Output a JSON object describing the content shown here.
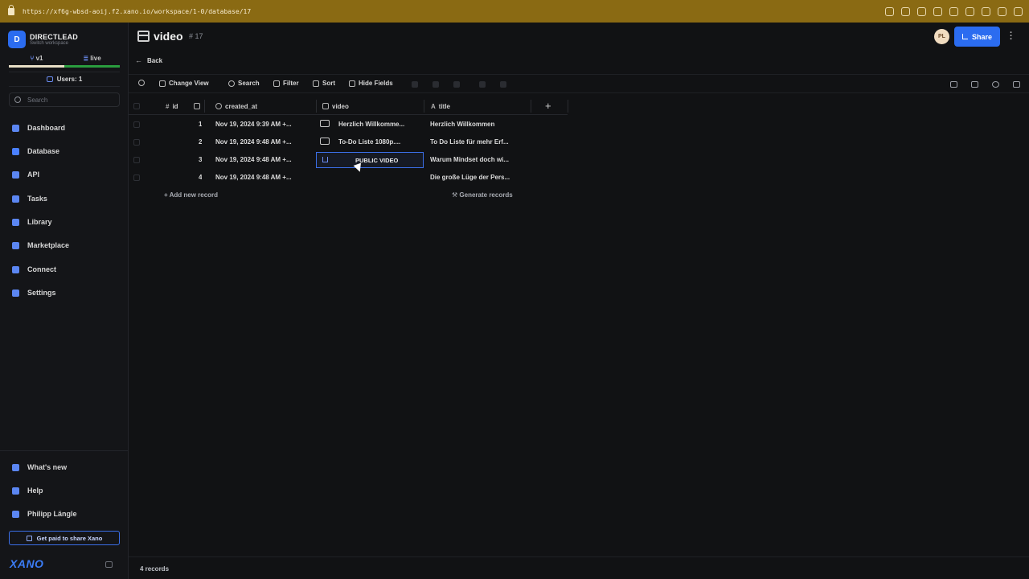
{
  "browser": {
    "url": "https://xf6g-wbsd-aoij.f2.xano.io/workspace/1-0/database/17"
  },
  "workspace": {
    "badge": "D",
    "name": "DIRECTLEAD",
    "sub": "Switch workspace"
  },
  "branches": {
    "v1": "v1",
    "live": "live"
  },
  "users_label": "Users: 1",
  "sidebar_search": {
    "placeholder": "Search"
  },
  "nav": [
    {
      "label": "Dashboard"
    },
    {
      "label": "Database"
    },
    {
      "label": "API"
    },
    {
      "label": "Tasks"
    },
    {
      "label": "Library"
    },
    {
      "label": "Marketplace"
    },
    {
      "label": "Connect"
    },
    {
      "label": "Settings"
    }
  ],
  "bottom_nav": [
    {
      "label": "What's new"
    },
    {
      "label": "Help"
    },
    {
      "label": "Philipp Längle"
    }
  ],
  "paid_label": "Get paid to share Xano",
  "logo": "XANO",
  "header": {
    "title": "video",
    "id": "# 17",
    "avatar": "PL",
    "share": "Share",
    "back": "Back"
  },
  "toolbar": {
    "change_view": "Change View",
    "search": "Search",
    "filter": "Filter",
    "sort": "Sort",
    "hide_fields": "Hide Fields"
  },
  "columns": [
    "id",
    "created_at",
    "video",
    "title"
  ],
  "rows": [
    {
      "id": "1",
      "created_at": "Nov 19, 2024 9:39 AM +...",
      "video": "Herzlich Willkomme...",
      "title": "Herzlich Willkommen"
    },
    {
      "id": "2",
      "created_at": "Nov 19, 2024 9:48 AM +...",
      "video": "To-Do Liste 1080p....",
      "title": "To Do Liste für mehr Erf..."
    },
    {
      "id": "3",
      "created_at": "Nov 19, 2024 9:48 AM +...",
      "video": "PUBLIC VIDEO",
      "title": "Warum Mindset doch wi..."
    },
    {
      "id": "4",
      "created_at": "Nov 19, 2024 9:48 AM +...",
      "video": "",
      "title": "Die große Lüge der Pers..."
    }
  ],
  "add_record": "+ Add new record",
  "generate_records": "Generate records",
  "record_count": "4 records"
}
